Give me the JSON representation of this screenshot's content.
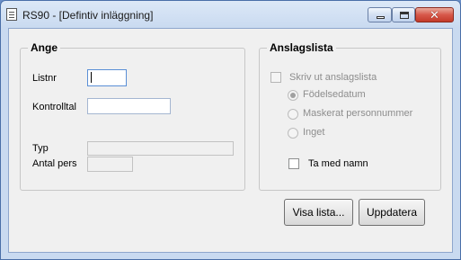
{
  "window": {
    "title": "RS90 - [Defintiv inläggning]",
    "icon": "document-icon"
  },
  "ange": {
    "legend": "Ange",
    "listnr_label": "Listnr",
    "listnr_value": "",
    "kontrolltal_label": "Kontrolltal",
    "kontrolltal_value": "",
    "typ_label": "Typ",
    "typ_value": "",
    "antal_pers_label": "Antal pers",
    "antal_pers_value": ""
  },
  "anslagslista": {
    "legend": "Anslagslista",
    "skriv_ut_label": "Skriv ut anslagslista",
    "skriv_ut_checked": false,
    "radio_options": [
      {
        "label": "Födelsedatum",
        "checked": true
      },
      {
        "label": "Maskerat personnummer",
        "checked": false
      },
      {
        "label": "Inget",
        "checked": false
      }
    ],
    "ta_med_namn_label": "Ta med namn",
    "ta_med_namn_checked": false
  },
  "buttons": {
    "visa_lista": "Visa lista...",
    "uppdatera": "Uppdatera"
  },
  "colors": {
    "title_bar": "#c9daf0",
    "close_button": "#c33a2a",
    "dialog_bg": "#f0f0f0",
    "disabled_text": "#8d8d8d"
  }
}
